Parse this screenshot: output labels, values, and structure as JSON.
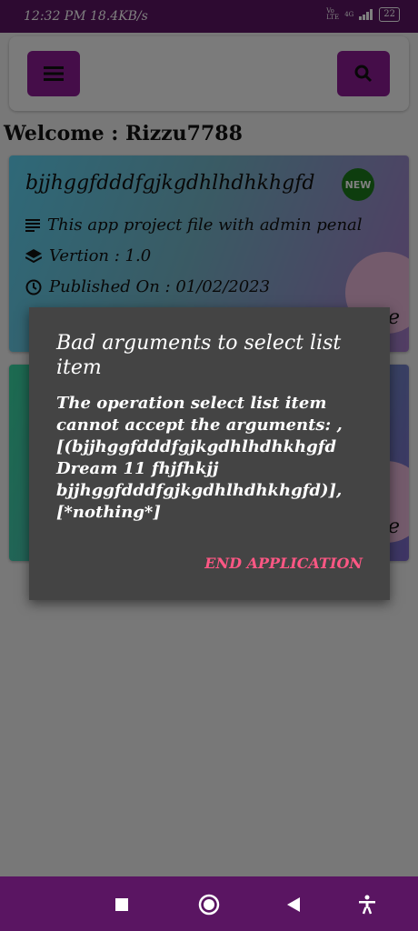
{
  "status_bar": {
    "time": "12:32 PM",
    "speed": "18.4KB/s",
    "network": "4G",
    "volte": "Vo LTE",
    "battery": "22"
  },
  "header": {
    "menu_icon": "hamburger-menu-icon",
    "search_icon": "search-icon",
    "accent_color": "#8a1a93"
  },
  "welcome": "Welcome : Rizzu7788",
  "cards": [
    {
      "title": "bjjhggfdddfgjkgdhlhdhkhgfd",
      "badge": "NEW",
      "description": "This app project file with admin penal",
      "version": "Vertion : 1.0",
      "published": "Published On : 01/02/2023",
      "tail": "e"
    },
    {
      "title": "",
      "tail": "e"
    }
  ],
  "dialog": {
    "title": "Bad arguments to select list item",
    "message": "The operation select list item cannot accept the arguments: , [(bjjhggfdddfgjkgdhlhdhkhgfd Dream 11 fhjfhkjj bjjhggfdddfgjkgdhlhdhkhgfd)], [*nothing*]",
    "button": "END APPLICATION",
    "button_color": "#ff5784"
  },
  "nav_bar": {
    "recents_icon": "square-recents-icon",
    "home_icon": "circle-home-icon",
    "back_icon": "triangle-back-icon",
    "accessibility_icon": "accessibility-icon",
    "color": "#5a1562"
  }
}
